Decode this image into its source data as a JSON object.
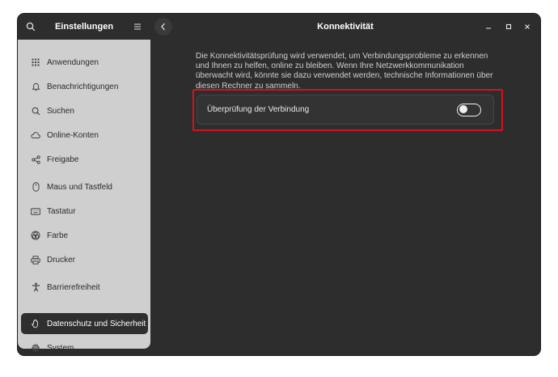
{
  "sidebar": {
    "title": "Einstellungen",
    "items": [
      {
        "label": "Anwendungen",
        "icon": "apps-grid-icon"
      },
      {
        "label": "Benachrichtigungen",
        "icon": "bell-icon"
      },
      {
        "label": "Suchen",
        "icon": "search-icon"
      },
      {
        "label": "Online-Konten",
        "icon": "cloud-icon"
      },
      {
        "label": "Freigabe",
        "icon": "share-icon"
      },
      {
        "label": "Maus und Tastfeld",
        "icon": "mouse-icon"
      },
      {
        "label": "Tastatur",
        "icon": "keyboard-icon"
      },
      {
        "label": "Farbe",
        "icon": "color-icon"
      },
      {
        "label": "Drucker",
        "icon": "printer-icon"
      },
      {
        "label": "Barrierefreiheit",
        "icon": "accessibility-icon"
      },
      {
        "label": "Datenschutz und Sicherheit",
        "icon": "privacy-hand-icon",
        "selected": true
      },
      {
        "label": "System",
        "icon": "system-gear-icon"
      }
    ]
  },
  "header": {
    "title": "Konnektivität"
  },
  "main": {
    "description": "Die Konnektivitätsprüfung wird verwendet, um Verbindungsprobleme zu erkennen und Ihnen zu helfen, online zu bleiben. Wenn Ihre Netzwerkkommunikation überwacht wird, könnte sie dazu verwendet werden, technische Informationen über diesen Rechner zu sammeln.",
    "setting_label": "Überprüfung der Verbindung",
    "setting_enabled": false
  },
  "colors": {
    "highlight": "#d4121e",
    "sidebar_bg": "#cfcfcf",
    "window_bg": "#2d2d2d"
  }
}
